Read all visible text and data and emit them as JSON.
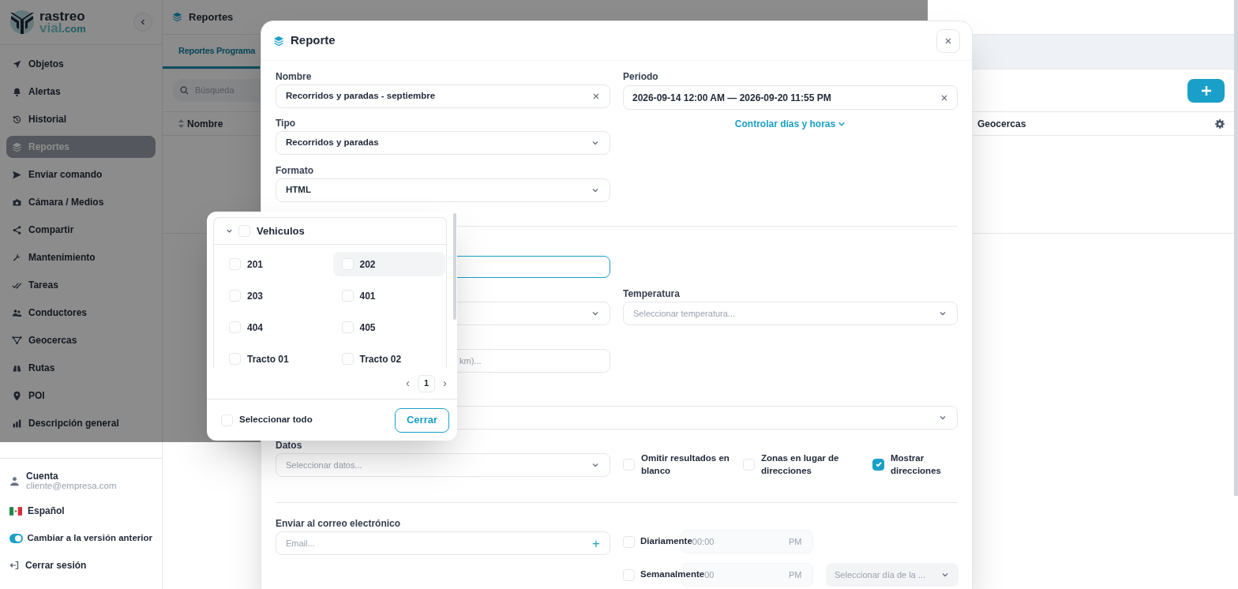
{
  "sidebar": {
    "logo": {
      "line1": "rastreo",
      "line2_main": "vial",
      "line2_suffix": ".com"
    },
    "items": [
      {
        "label": "Objetos",
        "selected": false
      },
      {
        "label": "Alertas",
        "selected": false
      },
      {
        "label": "Historial",
        "selected": false
      },
      {
        "label": "Reportes",
        "selected": true
      },
      {
        "label": "Enviar comando",
        "selected": false
      },
      {
        "label": "Cámara / Medios",
        "selected": false
      },
      {
        "label": "Compartir",
        "selected": false
      },
      {
        "label": "Mantenimiento",
        "selected": false
      },
      {
        "label": "Tareas",
        "selected": false
      },
      {
        "label": "Conductores",
        "selected": false
      },
      {
        "label": "Geocercas",
        "selected": false
      },
      {
        "label": "Rutas",
        "selected": false
      },
      {
        "label": "POI",
        "selected": false
      },
      {
        "label": "Descripción general",
        "selected": false
      }
    ],
    "account": {
      "label": "Cuenta",
      "email": "cliente@empresa.com"
    },
    "language": "Español",
    "legacy_toggle": {
      "label": "Cambiar a la versión anterior",
      "on": true
    },
    "logout": "Cerrar sesión"
  },
  "header": {
    "title": "Reportes"
  },
  "tabs": [
    {
      "label": "Reportes Programa",
      "selected": true
    }
  ],
  "search": {
    "placeholder": "Búsqueda"
  },
  "table": {
    "columns": [
      "Nombre",
      "Geocercas"
    ]
  },
  "modal": {
    "title": "Reporte",
    "name": {
      "label": "Nombre",
      "value": "Recorridos y paradas - septiembre"
    },
    "period": {
      "label": "Periodo",
      "value": "2026-09-14 12:00 AM — 2026-09-20 11:55 PM",
      "link": "Controlar días y horas"
    },
    "type": {
      "label": "Tipo",
      "value": "Recorridos y paradas"
    },
    "format": {
      "label": "Formato",
      "value": "HTML"
    },
    "covered_input": {
      "focused": true
    },
    "temperature": {
      "label": "Temperatura",
      "placeholder": "Seleccionar temperatura..."
    },
    "partly_covered_input": {
      "placeholder": "km)..."
    },
    "data": {
      "label": "Datos",
      "placeholder": "Seleccionar datos..."
    },
    "options": [
      {
        "label": "Omitir resultados en blanco",
        "checked": false
      },
      {
        "label": "Zonas en lugar de direcciones",
        "checked": false
      },
      {
        "label": "Mostrar direcciones",
        "checked": true
      }
    ],
    "email": {
      "label": "Enviar al correo electrónico",
      "placeholder": "Email...",
      "add": "+"
    },
    "schedules": [
      {
        "label": "Diariamente",
        "checked": false,
        "time_placeholder": "00:00",
        "meridiem": "PM"
      },
      {
        "label": "Semanalmente",
        "checked": false,
        "time_placeholder": "00",
        "meridiem": "PM",
        "day_placeholder": "Seleccionar día de la ..."
      }
    ]
  },
  "vehicle_picker": {
    "group": {
      "label": "Vehiculos",
      "expanded": true,
      "checked": false
    },
    "items": [
      {
        "label": "201",
        "checked": false,
        "highlighted": false
      },
      {
        "label": "202",
        "checked": false,
        "highlighted": true
      },
      {
        "label": "203",
        "checked": false,
        "highlighted": false
      },
      {
        "label": "401",
        "checked": false,
        "highlighted": false
      },
      {
        "label": "404",
        "checked": false,
        "highlighted": false
      },
      {
        "label": "405",
        "checked": false,
        "highlighted": false
      },
      {
        "label": "Tracto 01",
        "checked": false,
        "highlighted": false
      },
      {
        "label": "Tracto 02",
        "checked": false,
        "highlighted": false
      }
    ],
    "page": "1",
    "prev": "‹",
    "next": "›",
    "select_all": {
      "label": "Seleccionar todo",
      "checked": false
    },
    "close_button": "Cerrar"
  }
}
